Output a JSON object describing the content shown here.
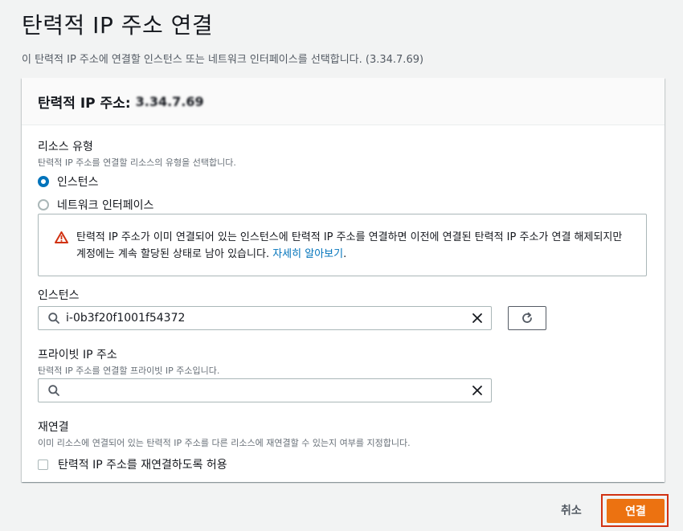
{
  "page": {
    "title": "탄력적 IP 주소 연결",
    "description": "이 탄력적 IP 주소에 연결할 인스턴스 또는 네트워크 인터페이스를 선택합니다. (3.34.7.69)"
  },
  "panel": {
    "title": "탄력적 IP 주소:",
    "ip_blurred": "3.34.7.69"
  },
  "resource_type": {
    "label": "리소스 유형",
    "description": "탄력적 IP 주소를 연결할 리소스의 유형을 선택합니다.",
    "options": [
      {
        "label": "인스턴스",
        "selected": true
      },
      {
        "label": "네트워크 인터페이스",
        "selected": false
      }
    ]
  },
  "alert": {
    "icon": "warning-icon",
    "text": "탄력적 IP 주소가 이미 연결되어 있는 인스턴스에 탄력적 IP 주소를 연결하면 이전에 연결된 탄력적 IP 주소가 연결 해제되지만 계정에는 계속 할당된 상태로 남아 있습니다.",
    "link": "자세히 알아보기",
    "suffix": "."
  },
  "instance": {
    "label": "인스턴스",
    "value": "i-0b3f20f1001f54372"
  },
  "private_ip": {
    "label": "프라이빗 IP 주소",
    "description": "탄력적 IP 주소를 연결할 프라이빗 IP 주소입니다.",
    "value": ""
  },
  "reassociate": {
    "label": "재연결",
    "description": "이미 리소스에 연결되어 있는 탄력적 IP 주소를 다른 리소스에 재연결할 수 있는지 여부를 지정합니다.",
    "checkbox_label": "탄력적 IP 주소를 재연결하도록 허용",
    "checked": false
  },
  "footer": {
    "cancel_label": "취소",
    "connect_label": "연결"
  },
  "colors": {
    "accent": "#0073bb",
    "primary_button": "#ec7211",
    "warning": "#d13212"
  }
}
